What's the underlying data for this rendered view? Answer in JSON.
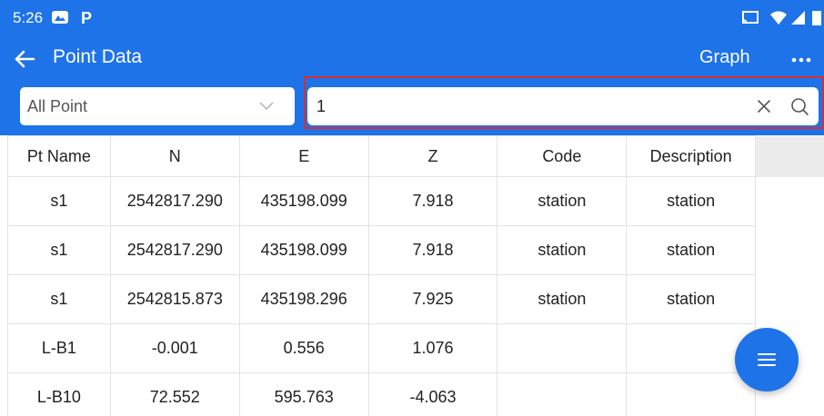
{
  "status_bar": {
    "time": "5:26"
  },
  "app_bar": {
    "title": "Point Data",
    "graph_label": "Graph"
  },
  "filter": {
    "selected": "All Point"
  },
  "search": {
    "value": "1",
    "placeholder": ""
  },
  "table": {
    "columns": [
      "Pt Name",
      "N",
      "E",
      "Z",
      "Code",
      "Description"
    ],
    "rows": [
      [
        "s1",
        "2542817.290",
        "435198.099",
        "7.918",
        "station",
        "station"
      ],
      [
        "s1",
        "2542817.290",
        "435198.099",
        "7.918",
        "station",
        "station"
      ],
      [
        "s1",
        "2542815.873",
        "435198.296",
        "7.925",
        "station",
        "station"
      ],
      [
        "L-B1",
        "-0.001",
        "0.556",
        "1.076",
        "",
        ""
      ],
      [
        "L-B10",
        "72.552",
        "595.763",
        "-4.063",
        "",
        ""
      ]
    ]
  },
  "icons": {
    "back": "arrow-left-icon",
    "more": "more-horiz-icon",
    "dropdown": "chevron-down-icon",
    "clear": "close-icon",
    "search": "search-icon",
    "fab": "menu-icon",
    "status_left": [
      "gallery-icon",
      "parking-icon"
    ],
    "status_right": [
      "cast-icon",
      "wifi-icon",
      "signal-icon",
      "battery-icon"
    ]
  },
  "colors": {
    "primary": "#1e73e8",
    "highlight_border": "#e02a2a",
    "header_filler": "#ececec"
  }
}
